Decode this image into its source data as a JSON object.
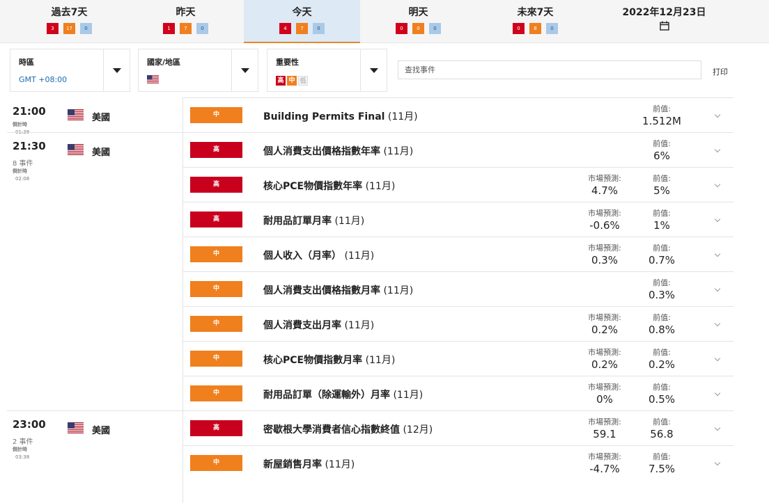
{
  "tabs": [
    {
      "label": "過去7天",
      "high": "3",
      "medium": "17",
      "low": "0",
      "active": false
    },
    {
      "label": "昨天",
      "high": "1",
      "medium": "7",
      "low": "0",
      "active": false
    },
    {
      "label": "今天",
      "high": "4",
      "medium": "7",
      "low": "0",
      "active": true
    },
    {
      "label": "明天",
      "high": "0",
      "medium": "0",
      "low": "0",
      "active": false
    },
    {
      "label": "未來7天",
      "high": "0",
      "medium": "8",
      "low": "0",
      "active": false
    }
  ],
  "date_picker": {
    "label": "2022年12月23日",
    "icon": "calendar-icon"
  },
  "filters": {
    "timezone": {
      "title": "時區",
      "value": "GMT +08:00"
    },
    "country": {
      "title": "國家/地區",
      "icon": "us-flag-icon"
    },
    "importance": {
      "title": "重要性",
      "chips": [
        "高",
        "中",
        "低"
      ]
    }
  },
  "search": {
    "placeholder": "查找事件"
  },
  "print_label": "打印",
  "labels": {
    "forecast": "市場預測:",
    "previous": "前值:",
    "countdown": "倒計時"
  },
  "colors": {
    "high": "#c8001e",
    "medium": "#f07f1e",
    "low": "#a9c9e8",
    "active_tab": "#dde9f5",
    "link": "#1e6bb0"
  },
  "groups": [
    {
      "time": "21:00",
      "count": "",
      "countdown": "01:38",
      "country": "美國",
      "events": [
        {
          "importance": "中",
          "level": "mid",
          "name": "Building Permits Final",
          "period": "(11月)",
          "forecast": "",
          "previous": "1.512M"
        }
      ]
    },
    {
      "time": "21:30",
      "count": "8 事件",
      "countdown": "02:08",
      "country": "美國",
      "events": [
        {
          "importance": "高",
          "level": "hi",
          "name": "個人消費支出價格指數年率",
          "period": "(11月)",
          "forecast": "",
          "previous": "6%"
        },
        {
          "importance": "高",
          "level": "hi",
          "name": "核心PCE物價指數年率",
          "period": "(11月)",
          "forecast": "4.7%",
          "previous": "5%"
        },
        {
          "importance": "高",
          "level": "hi",
          "name": "耐用品訂單月率",
          "period": "(11月)",
          "forecast": "-0.6%",
          "previous": "1%"
        },
        {
          "importance": "中",
          "level": "mid",
          "name": "個人收入（月率）",
          "period": "(11月)",
          "forecast": "0.3%",
          "previous": "0.7%"
        },
        {
          "importance": "中",
          "level": "mid",
          "name": "個人消費支出價格指數月率",
          "period": "(11月)",
          "forecast": "",
          "previous": "0.3%"
        },
        {
          "importance": "中",
          "level": "mid",
          "name": "個人消費支出月率",
          "period": "(11月)",
          "forecast": "0.2%",
          "previous": "0.8%"
        },
        {
          "importance": "中",
          "level": "mid",
          "name": "核心PCE物價指數月率",
          "period": "(11月)",
          "forecast": "0.2%",
          "previous": "0.2%"
        },
        {
          "importance": "中",
          "level": "mid",
          "name": "耐用品訂單（除運輸外）月率",
          "period": "(11月)",
          "forecast": "0%",
          "previous": "0.5%"
        }
      ]
    },
    {
      "time": "23:00",
      "count": "2 事件",
      "countdown": "03:38",
      "country": "美國",
      "events": [
        {
          "importance": "高",
          "level": "hi",
          "name": "密歇根大學消費者信心指數終值",
          "period": "(12月)",
          "forecast": "59.1",
          "previous": "56.8"
        },
        {
          "importance": "中",
          "level": "mid",
          "name": "新屋銷售月率",
          "period": "(11月)",
          "forecast": "-4.7%",
          "previous": "7.5%"
        }
      ]
    }
  ]
}
